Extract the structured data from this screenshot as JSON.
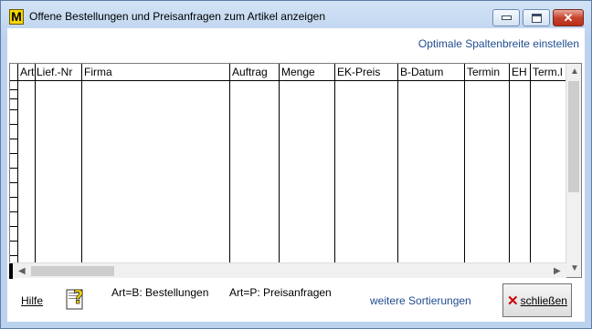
{
  "window": {
    "icon_letter": "M",
    "title": "Offene Bestellungen und Preisanfragen zum Artikel anzeigen"
  },
  "toolbar": {
    "optimal_width_link": "Optimale Spaltenbreite einstellen"
  },
  "grid": {
    "columns": [
      "Art",
      "Lief.-Nr",
      "Firma",
      "Auftrag",
      "Menge",
      "EK-Preis",
      "B-Datum",
      "Termin",
      "EH",
      "Term.l"
    ],
    "rows": []
  },
  "footer": {
    "help_label": "Hilfe",
    "legend_b": "Art=B: Bestellungen",
    "legend_p": "Art=P: Preisanfragen",
    "more_sorting_link": "weitere Sortierungen",
    "close_label": "schließen"
  },
  "colors": {
    "link": "#1f4c8f",
    "title_bar": "#c4d9ef"
  }
}
